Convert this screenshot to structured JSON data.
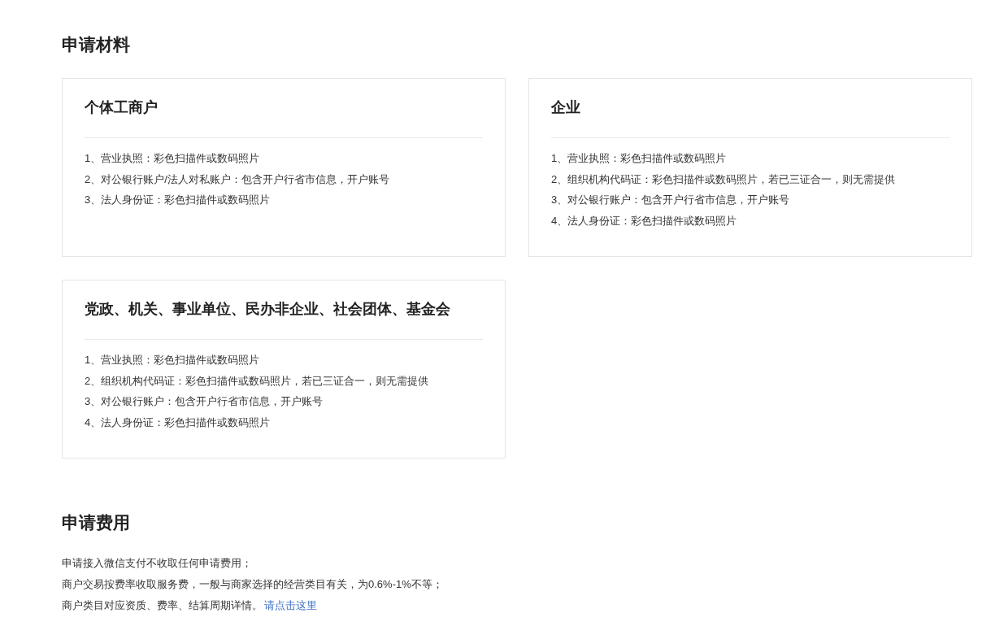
{
  "materials": {
    "title": "申请材料",
    "cards": [
      {
        "title": "个体工商户",
        "items": [
          "1、营业执照：彩色扫描件或数码照片",
          "2、对公银行账户/法人对私账户：包含开户行省市信息，开户账号",
          "3、法人身份证：彩色扫描件或数码照片"
        ]
      },
      {
        "title": "企业",
        "items": [
          "1、营业执照：彩色扫描件或数码照片",
          "2、组织机构代码证：彩色扫描件或数码照片，若已三证合一，则无需提供",
          "3、对公银行账户：包含开户行省市信息，开户账号",
          "4、法人身份证：彩色扫描件或数码照片"
        ]
      },
      {
        "title": "党政、机关、事业单位、民办非企业、社会团体、基金会",
        "items": [
          "1、营业执照：彩色扫描件或数码照片",
          "2、组织机构代码证：彩色扫描件或数码照片，若已三证合一，则无需提供",
          "3、对公银行账户：包含开户行省市信息，开户账号",
          "4、法人身份证：彩色扫描件或数码照片"
        ]
      }
    ]
  },
  "fees": {
    "title": "申请费用",
    "lines": [
      "申请接入微信支付不收取任何申请费用；",
      "商户交易按费率收取服务费，一般与商家选择的经营类目有关，为0.6%-1%不等；"
    ],
    "last_line": {
      "text": "商户类目对应资质、费率、结算周期详情。",
      "link": "请点击这里"
    }
  }
}
